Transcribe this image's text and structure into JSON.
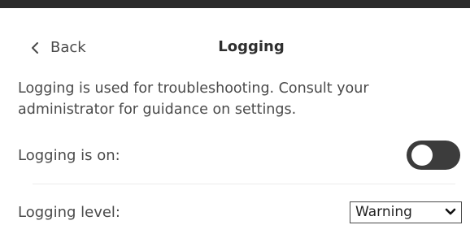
{
  "header": {
    "back_label": "Back",
    "back_icon": "chevron-left-icon",
    "title": "Logging"
  },
  "description": "Logging is used for troubleshooting. Consult your administrator for guidance on settings.",
  "settings": {
    "logging_on": {
      "label": "Logging is on:",
      "state": false
    },
    "logging_level": {
      "label": "Logging level:",
      "selected": "Warning",
      "icon": "chevron-down-icon"
    }
  },
  "colors": {
    "top_bar": "#2b2b2b",
    "toggle_track": "#3c3c3c",
    "text": "#4a4a4a"
  }
}
